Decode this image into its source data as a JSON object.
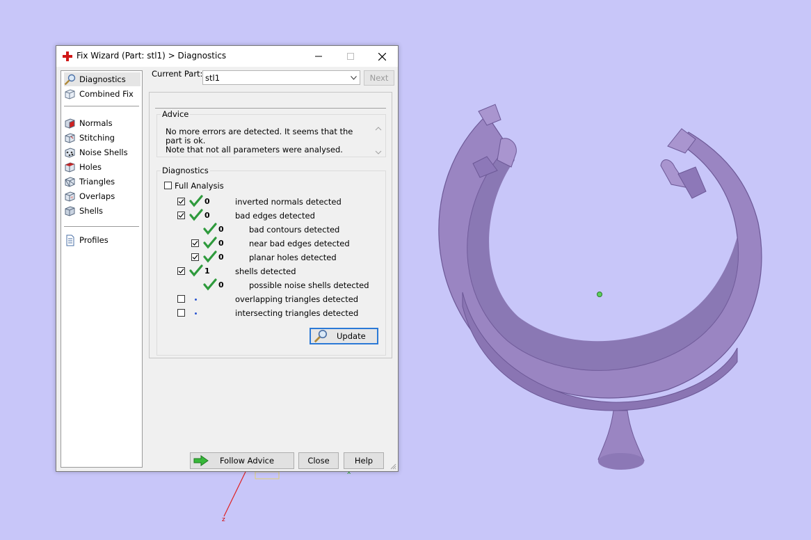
{
  "window": {
    "title": "Fix Wizard (Part: stl1) > Diagnostics",
    "minimize_icon": "minimize-icon",
    "maximize_icon": "maximize-icon",
    "close_icon": "close-icon"
  },
  "sidebar": {
    "items": [
      {
        "label": "Diagnostics",
        "icon": "magnifier-icon"
      },
      {
        "label": "Combined Fix",
        "icon": "cube-icon"
      },
      {
        "label": "Normals",
        "icon": "cube-red-face-icon"
      },
      {
        "label": "Stitching",
        "icon": "cube-stitch-icon"
      },
      {
        "label": "Noise Shells",
        "icon": "cube-dots-icon"
      },
      {
        "label": "Holes",
        "icon": "cube-hole-icon"
      },
      {
        "label": "Triangles",
        "icon": "cube-triangles-icon"
      },
      {
        "label": "Overlaps",
        "icon": "cube-overlap-icon"
      },
      {
        "label": "Shells",
        "icon": "cube-shells-icon"
      },
      {
        "label": "Profiles",
        "icon": "document-icon"
      }
    ]
  },
  "header": {
    "current_part_label": "Current Part:",
    "current_part_value": "stl1",
    "next_label": "Next"
  },
  "advice": {
    "label": "Advice",
    "text_line1": "No more errors are detected. It seems that the part is ok.",
    "text_line2": "Note that not all parameters were analysed."
  },
  "diagnostics": {
    "label": "Diagnostics",
    "full_analysis_label": "Full Analysis",
    "full_analysis_checked": false,
    "rows": [
      {
        "checked": true,
        "status": "ok",
        "count": "0",
        "label": "inverted normals detected"
      },
      {
        "checked": true,
        "status": "ok",
        "count": "0",
        "label": "bad edges detected"
      },
      {
        "checked": null,
        "status": "ok",
        "count": "0",
        "label": "bad contours detected"
      },
      {
        "checked": true,
        "status": "ok",
        "count": "0",
        "label": "near bad edges detected"
      },
      {
        "checked": true,
        "status": "ok",
        "count": "0",
        "label": "planar holes detected"
      },
      {
        "checked": true,
        "status": "ok",
        "count": "1",
        "label": "shells detected"
      },
      {
        "checked": null,
        "status": "ok",
        "count": "0",
        "label": "possible noise shells detected"
      },
      {
        "checked": false,
        "status": "pending",
        "count": "",
        "label": "overlapping triangles detected"
      },
      {
        "checked": false,
        "status": "pending",
        "count": "",
        "label": "intersecting triangles detected"
      }
    ],
    "update_label": "Update"
  },
  "footer": {
    "follow_advice_label": "Follow Advice",
    "close_label": "Close",
    "help_label": "Help"
  },
  "viewport": {
    "background": "#c8c6f9",
    "model_color": "#9a85c2",
    "axis_z_label": "z",
    "axis_x_label": "x"
  }
}
